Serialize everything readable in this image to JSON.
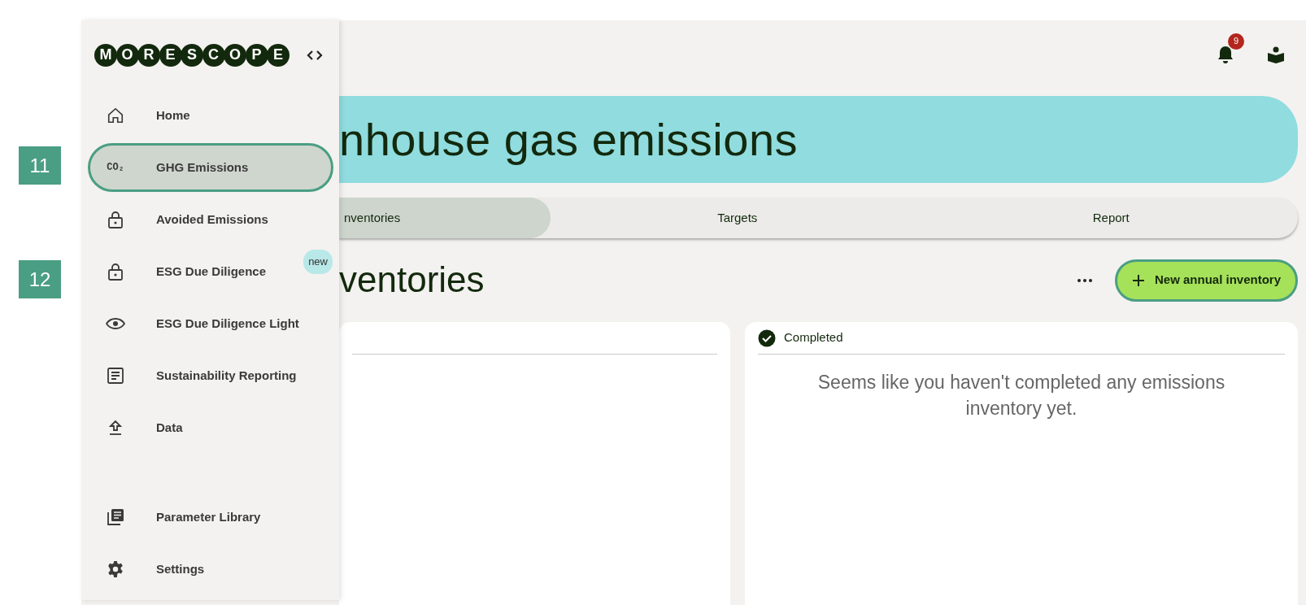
{
  "markers": [
    {
      "label": "11"
    },
    {
      "label": "12"
    }
  ],
  "sidebar": {
    "logo": "M O R E S C O P E",
    "items": [
      {
        "label": "Home",
        "kind": "home",
        "selected": false
      },
      {
        "label": "GHG Emissions",
        "kind": "text",
        "icon_text": "CO₂",
        "selected": true
      },
      {
        "label": "Avoided Emissions",
        "kind": "lock",
        "selected": false
      },
      {
        "label": "ESG Due Diligence",
        "kind": "lock",
        "selected": false,
        "badge": "new"
      },
      {
        "label": "ESG Due Diligence Light",
        "kind": "eye",
        "selected": false
      },
      {
        "label": "Sustainability Reporting",
        "kind": "document",
        "selected": false
      },
      {
        "label": "Data",
        "kind": "upload",
        "selected": false
      }
    ],
    "footer_items": [
      {
        "label": "Parameter Library",
        "kind": "library",
        "selected": false
      },
      {
        "label": "Settings",
        "kind": "gear",
        "selected": false
      }
    ]
  },
  "header": {
    "notification_count": "9"
  },
  "banner": {
    "title": "nhouse gas emissions"
  },
  "tabs": [
    {
      "label": "nventories",
      "selected": true
    },
    {
      "label": "Targets",
      "selected": false
    },
    {
      "label": "Report",
      "selected": false
    }
  ],
  "section": {
    "title": "ventories",
    "button": "New annual inventory"
  },
  "cards": [
    {
      "kind": "empty"
    },
    {
      "kind": "status",
      "status": "Completed",
      "message": "Seems like you haven't completed any emissions inventory yet."
    }
  ]
}
